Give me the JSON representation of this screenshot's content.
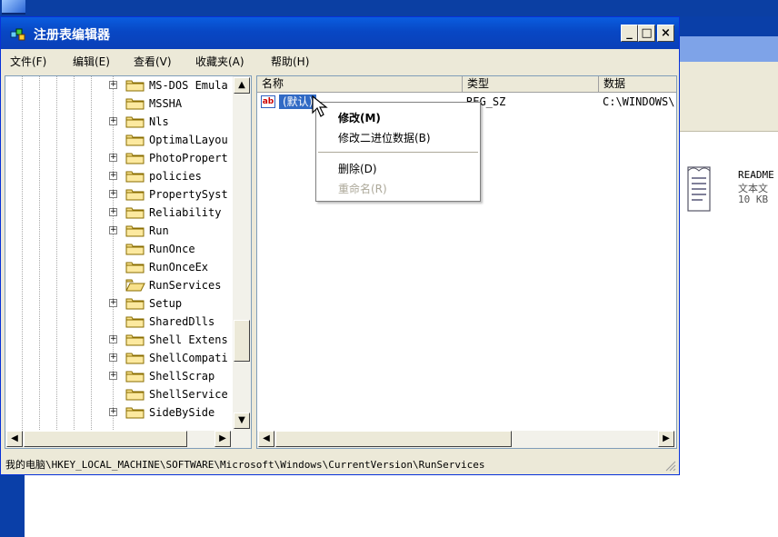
{
  "window": {
    "title": "注册表编辑器",
    "buttons": {
      "minimize": "_",
      "maximize": "□",
      "close": "×"
    }
  },
  "menubar": [
    "文件(F)",
    "编辑(E)",
    "查看(V)",
    "收藏夹(A)",
    "帮助(H)"
  ],
  "tree": {
    "items": [
      {
        "label": "MS-DOS Emula",
        "expandable": true
      },
      {
        "label": "MSSHA",
        "expandable": false
      },
      {
        "label": "Nls",
        "expandable": true
      },
      {
        "label": "OptimalLayou",
        "expandable": false
      },
      {
        "label": "PhotoPropert",
        "expandable": true
      },
      {
        "label": "policies",
        "expandable": true
      },
      {
        "label": "PropertySyst",
        "expandable": true
      },
      {
        "label": "Reliability",
        "expandable": true
      },
      {
        "label": "Run",
        "expandable": true
      },
      {
        "label": "RunOnce",
        "expandable": false
      },
      {
        "label": "RunOnceEx",
        "expandable": false
      },
      {
        "label": "RunServices",
        "expandable": false,
        "selected": true
      },
      {
        "label": "Setup",
        "expandable": true
      },
      {
        "label": "SharedDlls",
        "expandable": false
      },
      {
        "label": "Shell Extens",
        "expandable": true
      },
      {
        "label": "ShellCompati",
        "expandable": true
      },
      {
        "label": "ShellScrap",
        "expandable": true
      },
      {
        "label": "ShellService",
        "expandable": false
      },
      {
        "label": "SideBySide",
        "expandable": true
      }
    ]
  },
  "list": {
    "columns": [
      "名称",
      "类型",
      "数据"
    ],
    "rows": [
      {
        "name": "(默认)",
        "type": "REG_SZ",
        "data": "C:\\WINDOWS\\"
      }
    ]
  },
  "statusbar": {
    "path": "我的电脑\\HKEY_LOCAL_MACHINE\\SOFTWARE\\Microsoft\\Windows\\CurrentVersion\\RunServices"
  },
  "context_menu": {
    "items": [
      "修改(M)",
      "修改二进位数据(B)",
      "删除(D)",
      "重命名(R)"
    ]
  },
  "background_file": {
    "name": "README",
    "type": "文本文",
    "size": "10 KB"
  },
  "colors": {
    "titlebar": "#0a5ddf",
    "selection": "#316ac5",
    "window_face": "#ece9d8",
    "desktop": "#0a3fa8"
  }
}
